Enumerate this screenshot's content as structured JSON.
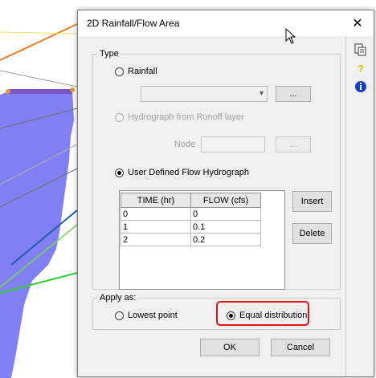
{
  "dialog": {
    "title": "2D Rainfall/Flow Area",
    "close_icon": "close-icon"
  },
  "type_group": {
    "label": "Type",
    "rainfall_label": "Rainfall",
    "rainfall_browse_label": "...",
    "hydrograph_label": "Hydrograph from Runoff layer",
    "node_label": "Node",
    "node_browse_label": "...",
    "user_defined_label": "User Defined Flow Hydrograph"
  },
  "table": {
    "columns": [
      "TIME (hr)",
      "FLOW (cfs)"
    ],
    "rows": [
      [
        "0",
        "0"
      ],
      [
        "1",
        "0.1"
      ],
      [
        "2",
        "0.2"
      ]
    ]
  },
  "buttons": {
    "insert": "Insert",
    "delete": "Delete",
    "ok": "OK",
    "cancel": "Cancel"
  },
  "apply_group": {
    "label": "Apply as:",
    "lowest_point_label": "Lowest point",
    "equal_distribution_label": "Equal distribution",
    "selected": "equal_distribution"
  },
  "side_tools": [
    "copy-icon",
    "help-icon",
    "info-icon"
  ],
  "colors": {
    "highlight": "#e0141e",
    "area_fill": "#8080f4",
    "info_icon": "#1a3fc4",
    "help_icon": "#d9c400"
  }
}
